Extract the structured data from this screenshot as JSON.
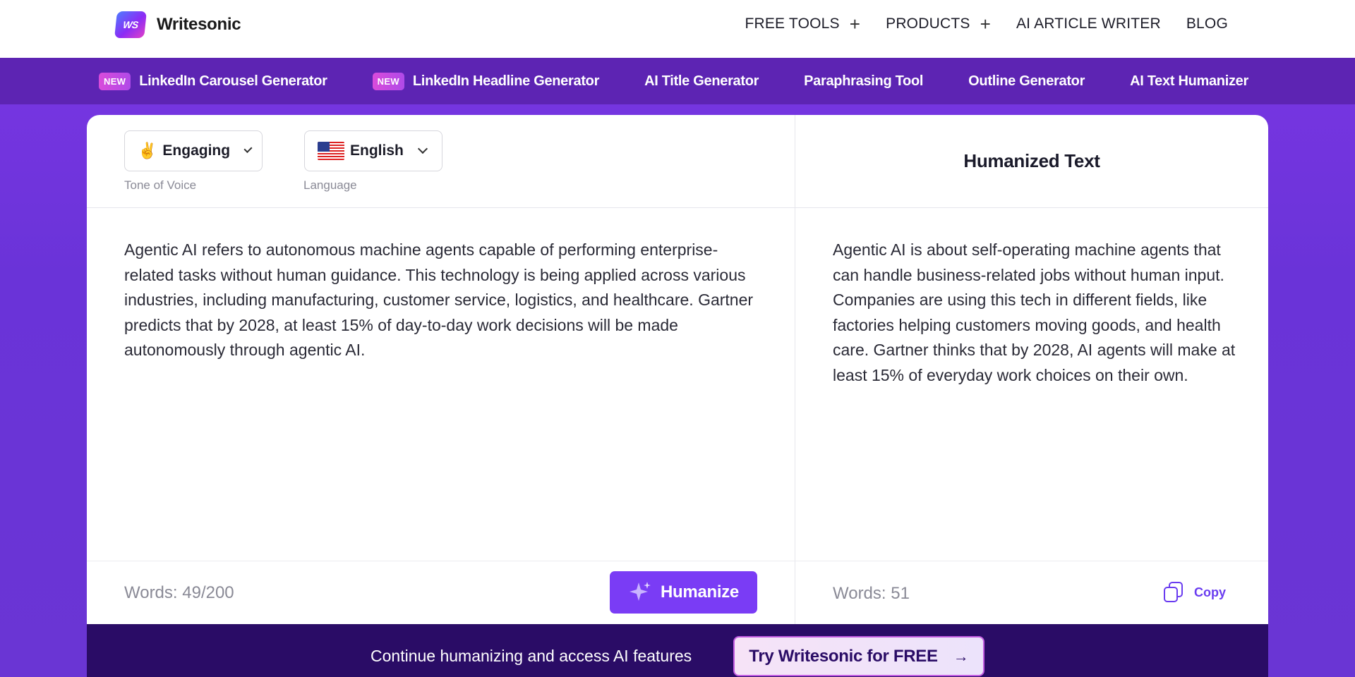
{
  "app": {
    "logo_badge": "WS",
    "name": "Writesonic"
  },
  "nav": {
    "items": [
      {
        "label": "FREE TOOLS",
        "expandable": true
      },
      {
        "label": "PRODUCTS",
        "expandable": true
      },
      {
        "label": "AI ARTICLE WRITER",
        "expandable": false
      },
      {
        "label": "BLOG",
        "expandable": false
      }
    ]
  },
  "tools": {
    "new_badge": "NEW",
    "items": [
      {
        "label": "LinkedIn Carousel Generator",
        "new": true
      },
      {
        "label": "LinkedIn Headline Generator",
        "new": true
      },
      {
        "label": "AI Title Generator",
        "new": false
      },
      {
        "label": "Paraphrasing Tool",
        "new": false
      },
      {
        "label": "Outline Generator",
        "new": false
      },
      {
        "label": "AI Text Humanizer",
        "new": false
      }
    ]
  },
  "editor": {
    "tone": {
      "icon": "hand-icon",
      "value": "Engaging",
      "label": "Tone of Voice"
    },
    "language": {
      "icon": "us-flag-icon",
      "value": "English",
      "label": "Language"
    },
    "input_text": "Agentic AI refers to autonomous machine agents capable of performing enterprise-related tasks without human guidance. This technology is being applied across various industries, including manufacturing, customer service, logistics, and healthcare. Gartner predicts that by 2028, at least 15% of day-to-day work decisions will be made autonomously through agentic AI.",
    "input_words": "Words: 49/200",
    "humanize_label": "Humanize",
    "output_title": "Humanized Text",
    "output_text": "Agentic AI is about self-operating machine agents that can handle business-related jobs without human input. Companies are using this tech in different fields, like factories helping customers moving goods, and health care. Gartner thinks that by 2028, AI agents will make at least 15% of everyday work choices on their own.",
    "output_words": "Words: 51",
    "copy_label": "Copy"
  },
  "cta": {
    "text": "Continue humanizing and access AI features",
    "button_label": "Try Writesonic for FREE"
  },
  "colors": {
    "accent": "#7a3cf5",
    "tools_bar": "#5d24b3",
    "cta_bg": "#2a0c66",
    "new_badge": "#d94bdb"
  }
}
